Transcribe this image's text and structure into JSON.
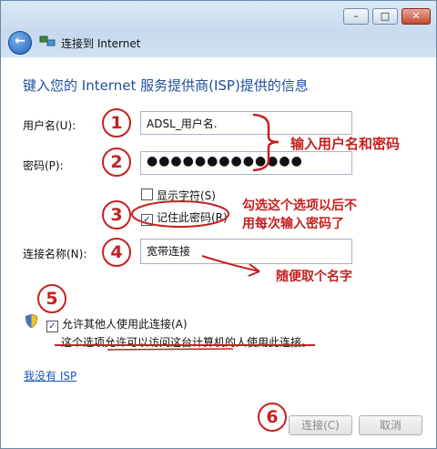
{
  "window": {
    "minimize_icon": "minimize-icon",
    "maximize_icon": "maximize-icon",
    "close_icon": "close-icon",
    "minimize_glyph": "–",
    "maximize_glyph": "□",
    "close_glyph": "✕"
  },
  "nav": {
    "back_glyph": "←",
    "title": "连接到 Internet"
  },
  "heading": "键入您的 Internet 服务提供商(ISP)提供的信息",
  "form": {
    "username_label": "用户名(U):",
    "username_value": "ADSL_用户名.",
    "password_label": "密码(P):",
    "password_value": "●●●●●●●●●●●●●",
    "show_chars_label": "显示字符(S)",
    "show_chars_checked": false,
    "remember_label": "记住此密码(R)",
    "remember_checked": true,
    "conn_name_label": "连接名称(N):",
    "conn_name_value": "宽带连接",
    "allow_others_label": "允许其他人使用此连接(A)",
    "allow_others_checked": true,
    "allow_others_desc": "这个选项允许可以访问这台计算机的人使用此连接。",
    "no_isp_link": "我没有 ISP"
  },
  "buttons": {
    "connect": "连接(C)",
    "cancel": "取消"
  },
  "annotations": {
    "n1": "1",
    "n2": "2",
    "n3": "3",
    "n4": "4",
    "n5": "5",
    "n6": "6",
    "note_credentials": "输入用户名和密码",
    "note_remember_1": "勾选这个选项以后不",
    "note_remember_2": "用每次输入密码了",
    "note_name": "随便取个名字",
    "color": "#c62020"
  }
}
